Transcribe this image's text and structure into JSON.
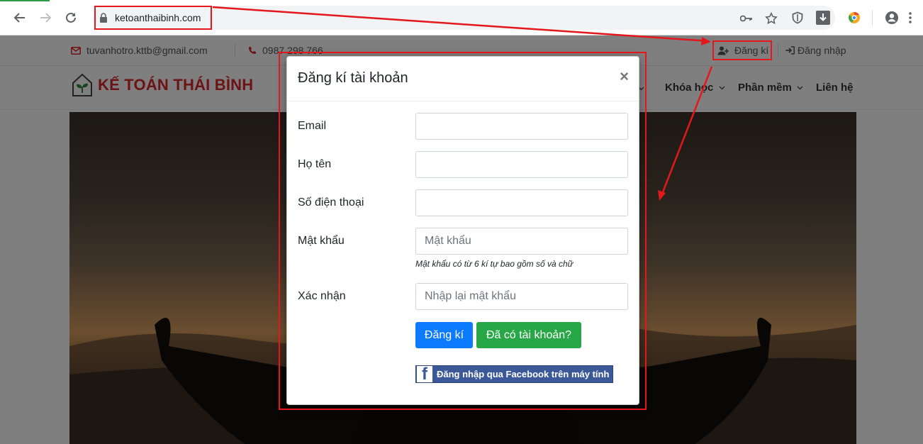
{
  "browser": {
    "url": "ketoanthaibinh.com",
    "icons": [
      "back-arrow-icon",
      "forward-arrow-icon",
      "reload-icon",
      "lock-icon",
      "key-icon",
      "star-icon",
      "shield-icon",
      "download-extension-icon",
      "chrome-extension-icon",
      "account-icon",
      "more-menu-icon",
      "download-icon"
    ]
  },
  "topbar": {
    "email": "tuvanhotro.kttb@gmail.com",
    "phone": "0987 298 766",
    "register": "Đăng kí",
    "login": "Đăng nhập"
  },
  "header": {
    "logo_text": "KẾ TOÁN THÁI BÌNH",
    "menu": [
      {
        "label": "Khóa học"
      },
      {
        "label": "Phần mềm"
      },
      {
        "label": "Liên hệ"
      }
    ]
  },
  "modal": {
    "title": "Đăng kí tài khoản",
    "close": "×",
    "fields": {
      "email_label": "Email",
      "name_label": "Họ tên",
      "phone_label": "Số điện thoại",
      "password_label": "Mật khẩu",
      "password_placeholder": "Mật khẩu",
      "password_help": "Mật khẩu có từ 6 kí tự bao gồm số và chữ",
      "confirm_label": "Xác nhận",
      "confirm_placeholder": "Nhập lại mật khẩu"
    },
    "register_button": "Đăng kí",
    "have_account_button": "Đã có tài khoản?",
    "facebook_button": "Đăng nhập qua Facebook trên máy tính"
  },
  "colors": {
    "annotation_red": "#e4171d",
    "primary_blue": "#0d7bff",
    "success_green": "#27a745",
    "facebook_blue": "#3b5998",
    "logo_red": "#d9262b"
  }
}
